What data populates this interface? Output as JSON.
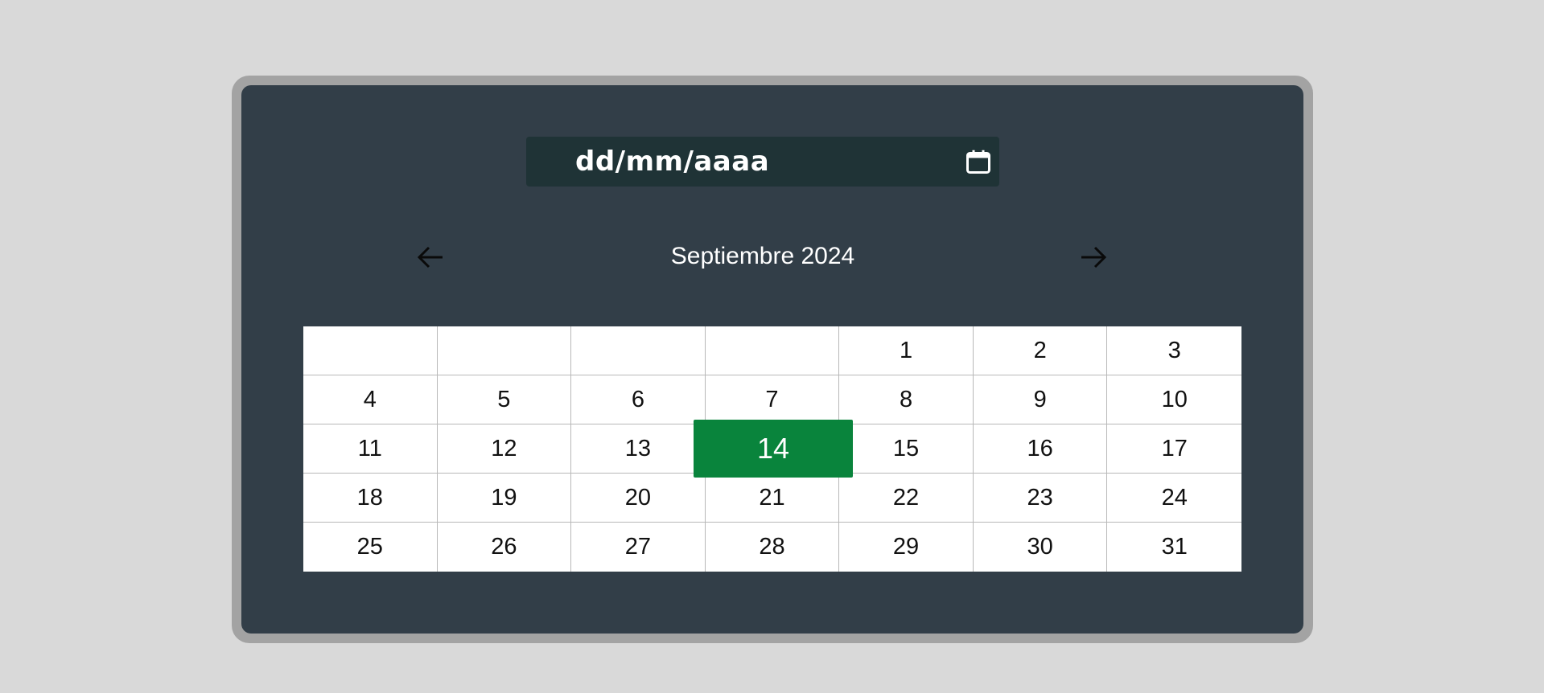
{
  "date_input": {
    "placeholder": "dd/mm/aaaa",
    "icon": "calendar-icon"
  },
  "calendar": {
    "month_label": "Septiembre 2024",
    "prev_icon": "arrow-left-icon",
    "next_icon": "arrow-right-icon",
    "weeks": [
      [
        "",
        "",
        "",
        "",
        "1",
        "2",
        "3"
      ],
      [
        "4",
        "5",
        "6",
        "7",
        "8",
        "9",
        "10"
      ],
      [
        "11",
        "12",
        "13",
        "14",
        "15",
        "16",
        "17"
      ],
      [
        "18",
        "19",
        "20",
        "21",
        "22",
        "23",
        "24"
      ],
      [
        "25",
        "26",
        "27",
        "28",
        "29",
        "30",
        "31"
      ]
    ],
    "selected_day": "14"
  },
  "colors": {
    "page_background": "#d9d9d9",
    "frame": "#a3a3a3",
    "panel": "#323e48",
    "input_background": "#1f3336",
    "selected": "#09843c",
    "text_light": "#ffffff",
    "text_dark": "#111111"
  }
}
